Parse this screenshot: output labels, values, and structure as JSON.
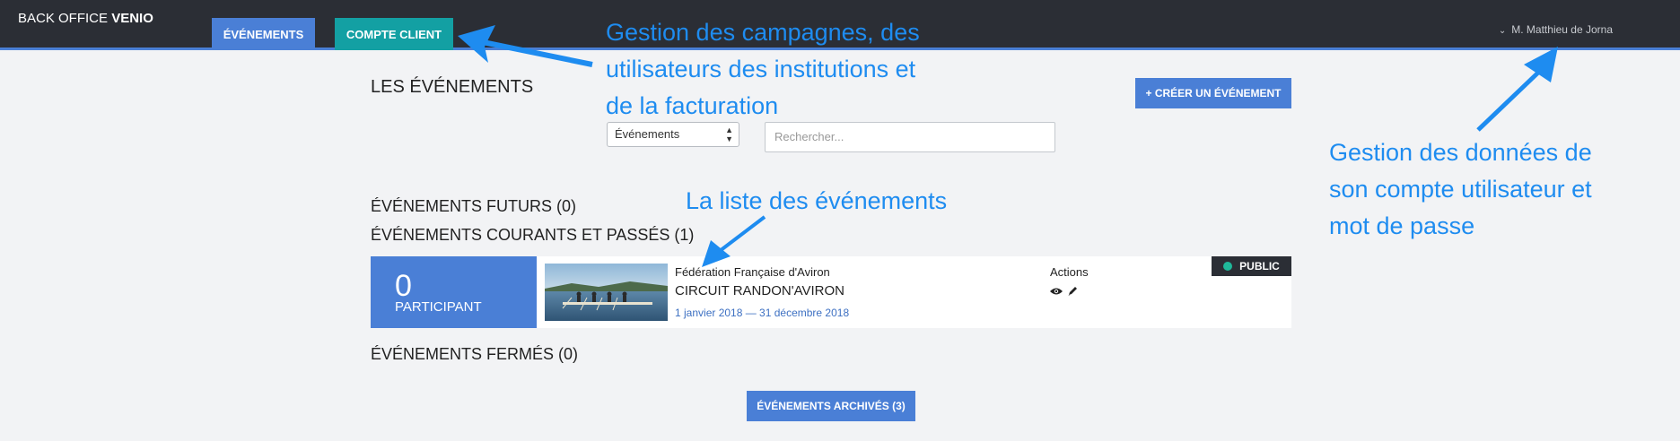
{
  "header": {
    "brand_light": "BACK OFFICE",
    "brand_bold": "VENIO",
    "nav": {
      "events": "ÉVÉNEMENTS",
      "client": "COMPTE CLIENT"
    },
    "user": "M. Matthieu de Jorna",
    "user_icon": "chevron-down-icon"
  },
  "main": {
    "title": "LES ÉVÉNEMENTS",
    "create_label": "+ CRÉER UN ÉVÉNEMENT",
    "filter_value": "Événements",
    "search_placeholder": "Rechercher...",
    "sections": {
      "future": "ÉVÉNEMENTS FUTURS (0)",
      "current": "ÉVÉNEMENTS COURANTS ET PASSÉS (1)",
      "closed": "ÉVÉNEMENTS FERMÉS (0)"
    },
    "event": {
      "participants": "0",
      "participants_label": "PARTICIPANT",
      "organizer": "Fédération Française d'Aviron",
      "name": "CIRCUIT RANDON'AVIRON",
      "dates": "1 janvier 2018 — 31 décembre 2018",
      "actions_label": "Actions",
      "action_icons": [
        "eye-icon",
        "pencil-icon"
      ],
      "status": "PUBLIC",
      "status_color": "#1fb89a"
    },
    "archive_label": "ÉVÉNEMENTS ARCHIVÉS (3)"
  },
  "annotations": {
    "campaigns": "Gestion des campagnes, des\nutilisateurs des institutions et\nde la facturation",
    "list": "La liste des événements",
    "account": "Gestion des données de\nson compte utilisateur et\nmot de passe"
  },
  "colors": {
    "topbar": "#2b2e35",
    "primary": "#4a7fd6",
    "teal": "#13a0a3",
    "annotation": "#1e8cf0"
  }
}
